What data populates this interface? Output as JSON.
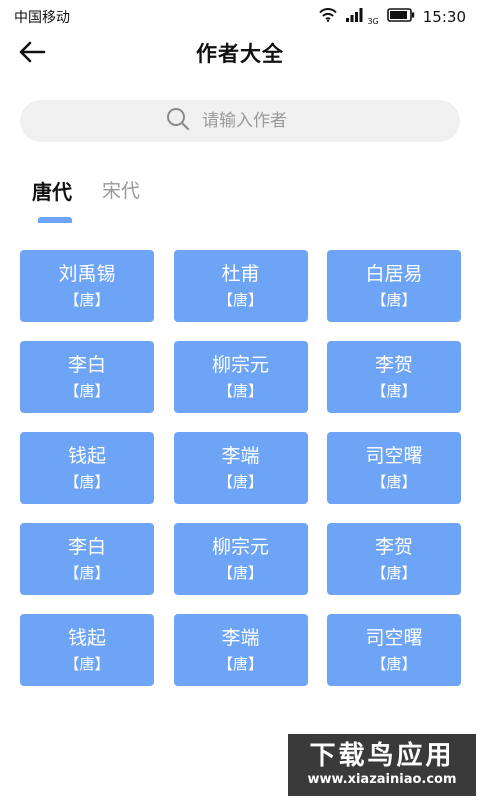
{
  "status_bar": {
    "carrier": "中国移动",
    "network": "3G",
    "time": "15:30"
  },
  "header": {
    "title": "作者大全"
  },
  "search": {
    "placeholder": "请输入作者"
  },
  "tabs": [
    {
      "label": "唐代",
      "active": true
    },
    {
      "label": "宋代",
      "active": false
    }
  ],
  "authors": [
    {
      "name": "刘禹锡",
      "dynasty": "【唐】"
    },
    {
      "name": "杜甫",
      "dynasty": "【唐】"
    },
    {
      "name": "白居易",
      "dynasty": "【唐】"
    },
    {
      "name": "李白",
      "dynasty": "【唐】"
    },
    {
      "name": "柳宗元",
      "dynasty": "【唐】"
    },
    {
      "name": "李贺",
      "dynasty": "【唐】"
    },
    {
      "name": "钱起",
      "dynasty": "【唐】"
    },
    {
      "name": "李端",
      "dynasty": "【唐】"
    },
    {
      "name": "司空曙",
      "dynasty": "【唐】"
    },
    {
      "name": "李白",
      "dynasty": "【唐】"
    },
    {
      "name": "柳宗元",
      "dynasty": "【唐】"
    },
    {
      "name": "李贺",
      "dynasty": "【唐】"
    },
    {
      "name": "钱起",
      "dynasty": "【唐】"
    },
    {
      "name": "李端",
      "dynasty": "【唐】"
    },
    {
      "name": "司空曙",
      "dynasty": "【唐】"
    }
  ],
  "watermark": {
    "title": "下载鸟应用",
    "url": "www.xiazainiao.com"
  },
  "colors": {
    "accent": "#6ea4f6",
    "search_bg": "#f0f0f0",
    "inactive_tab": "#999999"
  },
  "icons": {
    "back": "arrow-left-icon",
    "search": "search-icon",
    "wifi": "wifi-icon",
    "signal": "signal-icon",
    "battery": "battery-icon"
  }
}
